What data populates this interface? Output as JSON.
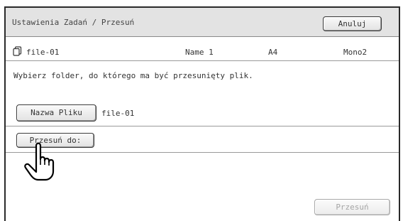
{
  "header": {
    "title": "Ustawienia Zadań / Przesuń",
    "cancel_label": "Anuluj"
  },
  "file_info": {
    "icon": "file-icon",
    "name": "file-01",
    "user": "Name 1",
    "paper_size": "A4",
    "color_mode": "Mono2"
  },
  "instruction": "Wybierz folder, do którego ma być przesunięty plik.",
  "file_name_field": {
    "button_label": "Nazwa Pliku",
    "value": "file-01"
  },
  "move_to": {
    "button_label": "Przesuń do:"
  },
  "footer": {
    "move_label": "Przesuń"
  },
  "cursor": "pointing-hand-icon"
}
